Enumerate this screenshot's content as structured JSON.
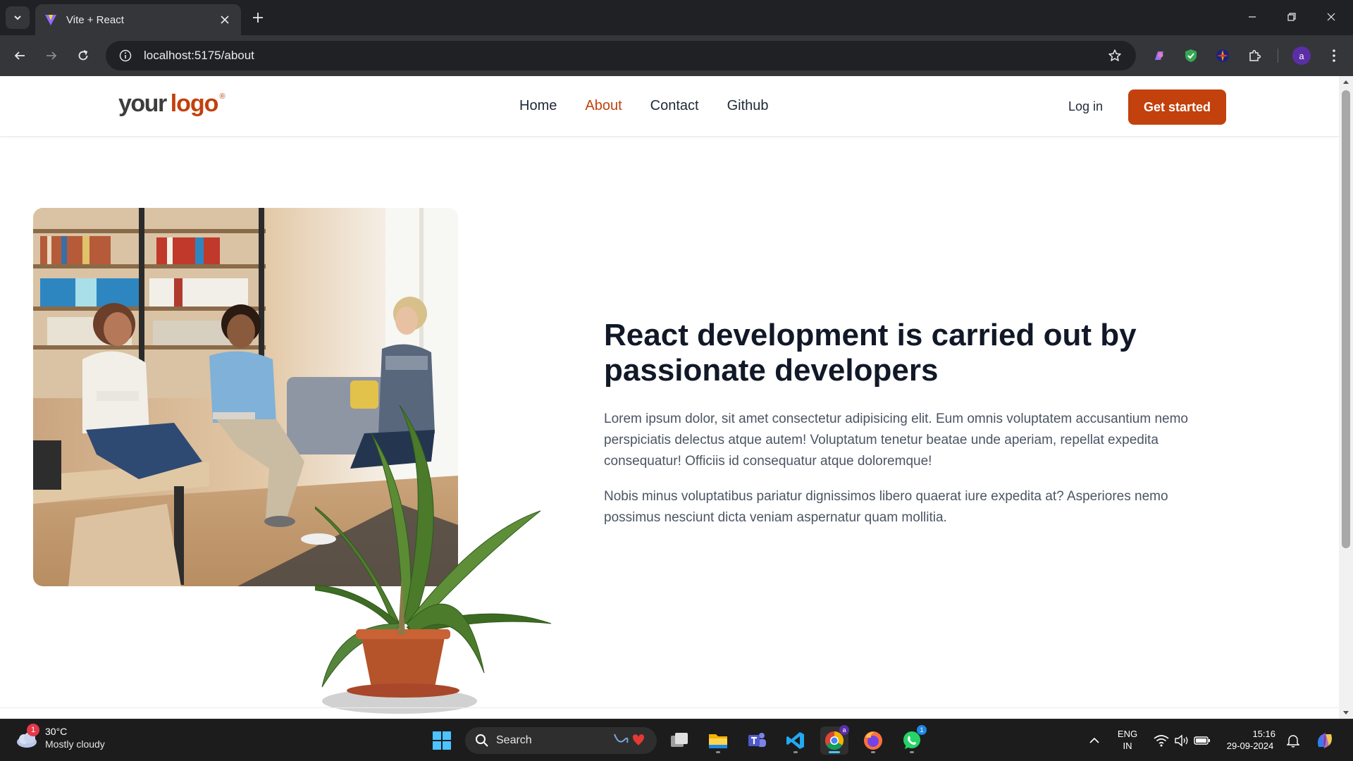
{
  "browser": {
    "tab_title": "Vite + React",
    "url": "localhost:5175/about",
    "profile_initial": "a"
  },
  "site": {
    "logo_your": "your",
    "logo_logo": "logo",
    "logo_mark": "®",
    "nav": [
      {
        "label": "Home",
        "active": false
      },
      {
        "label": "About",
        "active": true
      },
      {
        "label": "Contact",
        "active": false
      },
      {
        "label": "Github",
        "active": false
      }
    ],
    "login_label": "Log in",
    "cta_label": "Get started",
    "accent_color": "#c2410c"
  },
  "hero": {
    "title": "React development is carried out by passionate developers",
    "paragraph1": "Lorem ipsum dolor, sit amet consectetur adipisicing elit. Eum omnis voluptatem accusantium nemo perspiciatis delectus atque autem! Voluptatum tenetur beatae unde aperiam, repellat expedita consequatur! Officiis id consequatur atque doloremque!",
    "paragraph2": "Nobis minus voluptatibus pariatur dignissimos libero quaerat iure expedita at? Asperiores nemo possimus nesciunt dicta veniam aspernatur quam mollitia."
  },
  "taskbar": {
    "weather_temp": "30°C",
    "weather_desc": "Mostly cloudy",
    "weather_badge": "1",
    "search_label": "Search",
    "chrome_badge": "a",
    "whatsapp_badge": "1",
    "lang_line1": "ENG",
    "lang_line2": "IN",
    "time": "15:16",
    "date": "29-09-2024",
    "icons": [
      "windows-start-icon",
      "task-view-icon",
      "file-explorer-icon",
      "teams-icon",
      "vscode-icon",
      "chrome-icon",
      "firefox-icon",
      "whatsapp-icon"
    ]
  }
}
